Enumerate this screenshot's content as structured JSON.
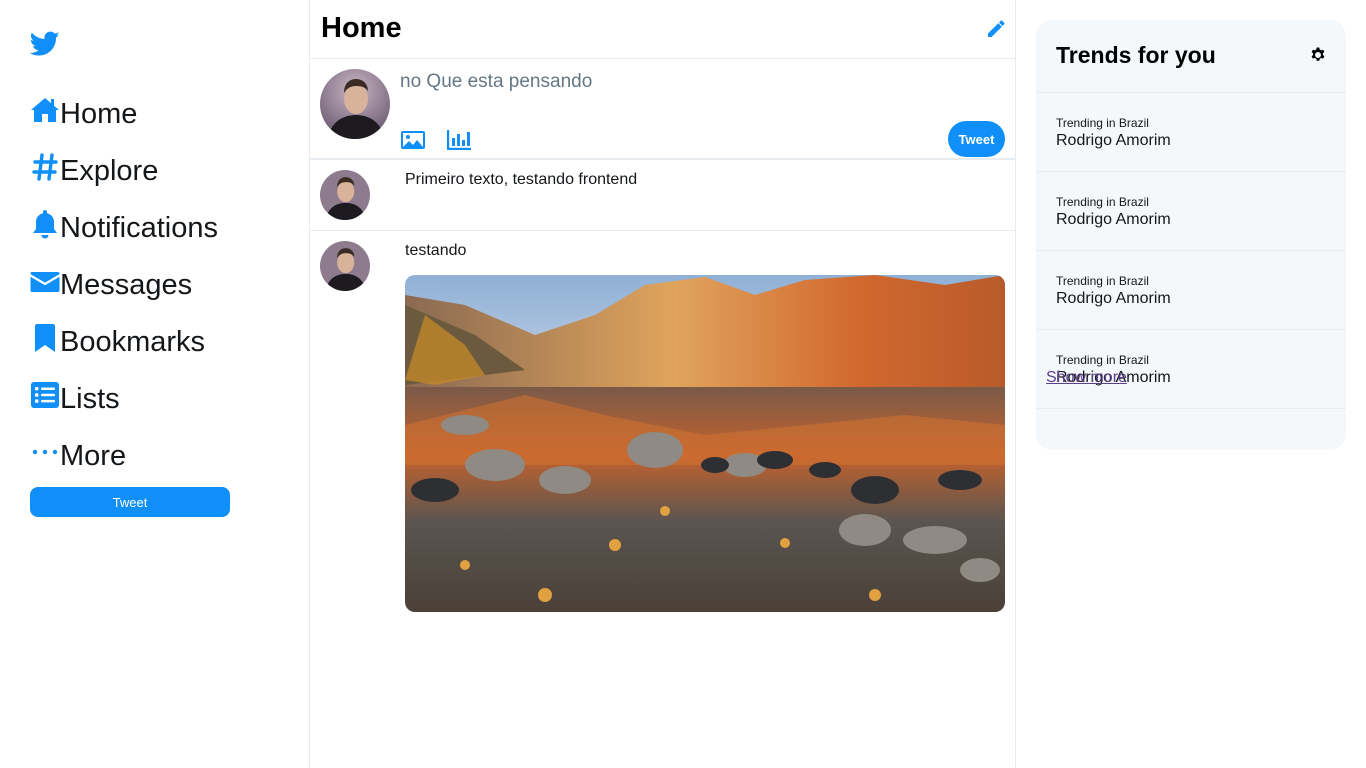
{
  "colors": {
    "accent": "#0f8ff7",
    "border": "#e6ecf0",
    "panel": "#f5f8fa"
  },
  "sidebar": {
    "logo_icon": "twitter-bird-icon",
    "items": [
      {
        "label": "Home",
        "icon": "home-icon"
      },
      {
        "label": "Explore",
        "icon": "hashtag-icon"
      },
      {
        "label": "Notifications",
        "icon": "bell-icon"
      },
      {
        "label": "Messages",
        "icon": "envelope-icon"
      },
      {
        "label": "Bookmarks",
        "icon": "bookmark-icon"
      },
      {
        "label": "Lists",
        "icon": "list-icon"
      },
      {
        "label": "More",
        "icon": "more-icon"
      }
    ],
    "tweet_label": "Tweet"
  },
  "main": {
    "title": "Home",
    "composer": {
      "placeholder": "no Que esta pensando",
      "tweet_label": "Tweet"
    },
    "posts": [
      {
        "text": "Primeiro texto, testando frontend",
        "has_image": false
      },
      {
        "text": "testando",
        "has_image": true,
        "image": "mountain-lake-landscape"
      }
    ]
  },
  "trends": {
    "title": "Trends for you",
    "items": [
      {
        "meta": "Trending in Brazil",
        "name": "Rodrigo Amorim"
      },
      {
        "meta": "Trending in Brazil",
        "name": "Rodrigo Amorim"
      },
      {
        "meta": "Trending in Brazil",
        "name": "Rodrigo Amorim"
      },
      {
        "meta": "Trending in Brazil",
        "name": "Rodrigo Amorim"
      }
    ],
    "show_more": "Show more"
  }
}
